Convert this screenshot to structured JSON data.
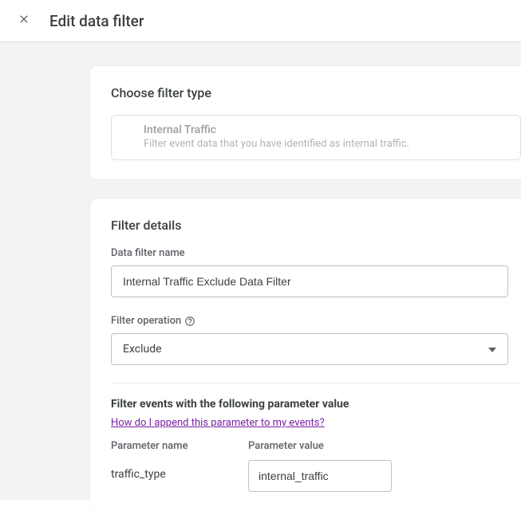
{
  "header": {
    "title": "Edit data filter"
  },
  "filterType": {
    "sectionTitle": "Choose filter type",
    "name": "Internal Traffic",
    "description": "Filter event data that you have identified as internal traffic."
  },
  "details": {
    "sectionTitle": "Filter details",
    "nameLabel": "Data filter name",
    "nameValue": "Internal Traffic Exclude Data Filter",
    "operationLabel": "Filter operation",
    "operationValue": "Exclude",
    "paramHeading": "Filter events with the following parameter value",
    "helpLink": "How do I append this parameter to my events?",
    "paramNameLabel": "Parameter name",
    "paramValueLabel": "Parameter value",
    "paramName": "traffic_type",
    "paramValue": "internal_traffic"
  }
}
